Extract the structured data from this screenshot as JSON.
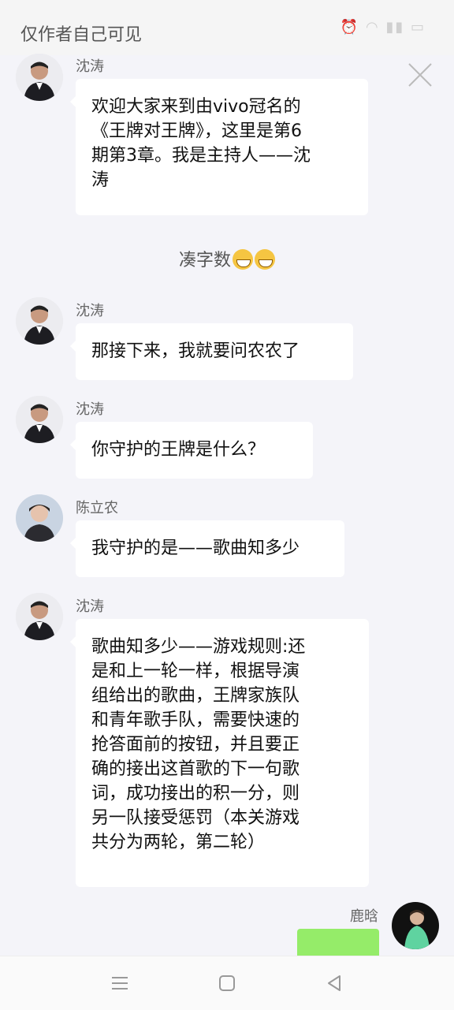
{
  "status_bar": {
    "title": "仅作者自己可见",
    "icons": [
      "alarm-icon",
      "bluetooth-icon",
      "wifi-icon",
      "hd-icon",
      "signal-icon",
      "signal-icon",
      "battery-icon"
    ]
  },
  "messages": [
    {
      "sender": "沈涛",
      "text": "欢迎大家来到由vivo冠名的\n《王牌对王牌》，这里是第6\n期第3章。我是主持人——沈\n涛"
    },
    {
      "sender": "沈涛",
      "text": "那接下来，我就要问农农了"
    },
    {
      "sender": "沈涛",
      "text": "你守护的王牌是什么？"
    },
    {
      "sender": "陈立农",
      "text": "我守护的是——歌曲知多少"
    },
    {
      "sender": "沈涛",
      "text": "歌曲知多少——游戏规则:还\n是和上一轮一样，根据导演\n组给出的歌曲，王牌家族队\n和青年歌手队，需要快速的\n抢答面前的按钮，并且要正\n确的接出这首歌的下一句歌\n词，成功接出的积一分，则\n另一队接受惩罚（本关游戏\n共分为两轮，第二轮）"
    },
    {
      "sender": "鹿晗",
      "text": ""
    }
  ],
  "system_message": "凑字数",
  "colors": {
    "background": "#f4f4f9",
    "bubble": "#ffffff",
    "self_bubble": "#95ec69"
  }
}
